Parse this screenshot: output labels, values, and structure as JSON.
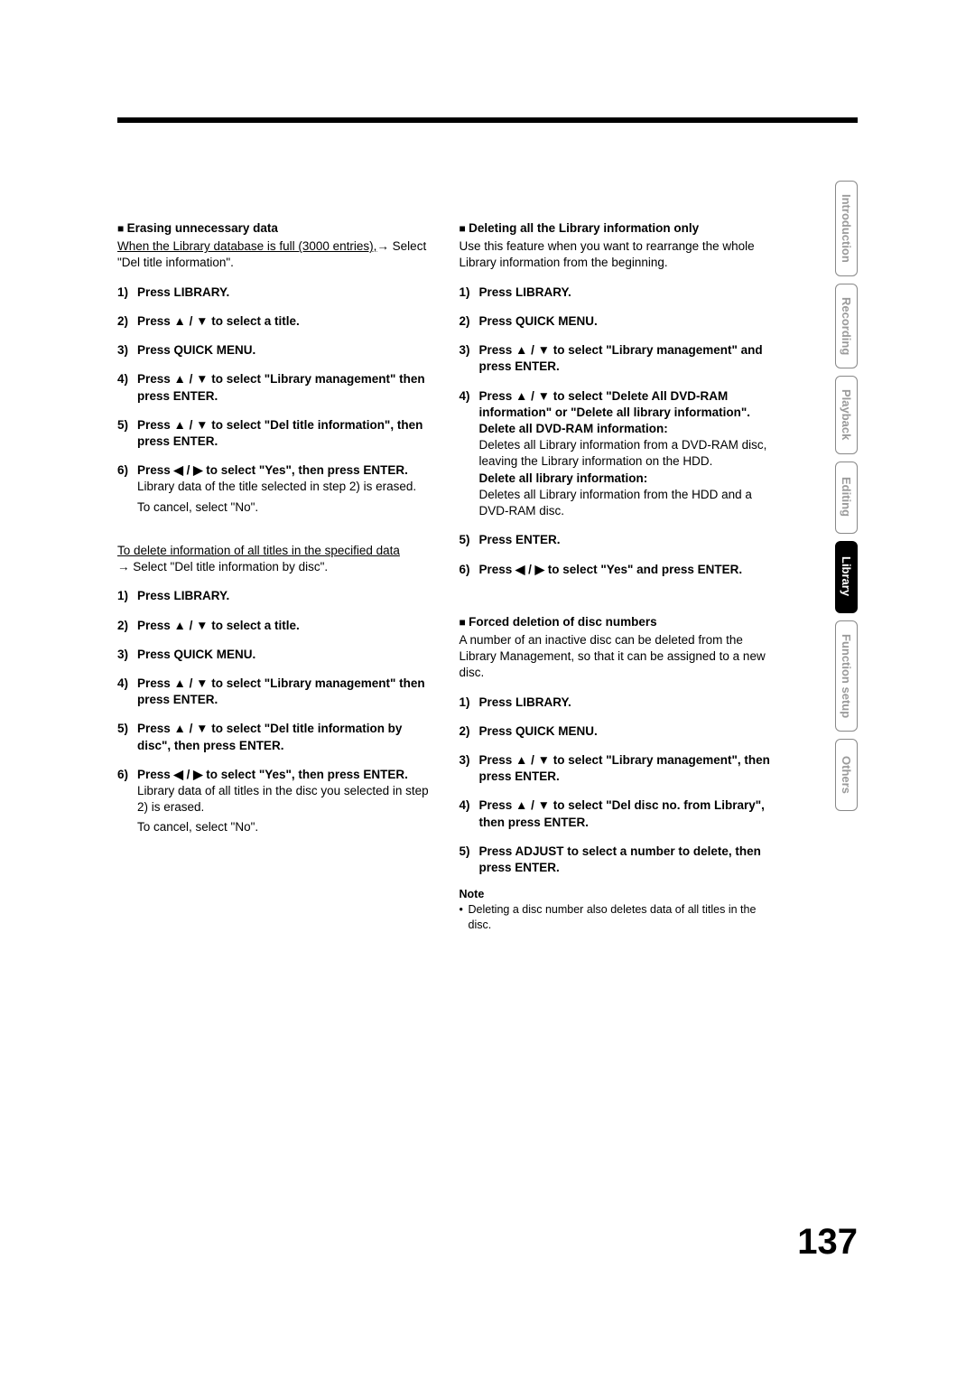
{
  "page_number": "137",
  "tabs": [
    "Introduction",
    "Recording",
    "Playback",
    "Editing",
    "Library",
    "Function setup",
    "Others"
  ],
  "active_tab_index": 4,
  "left": {
    "sec1": {
      "title": "Erasing unnecessary data",
      "intro_underline": "When the Library database is full (3000 entries),",
      "intro_arrow": "→",
      "intro_rest": "Select \"Del title information\".",
      "steps": [
        {
          "num": "1)",
          "head": "Press LIBRARY."
        },
        {
          "num": "2)",
          "head": "Press ▲ / ▼ to select a title."
        },
        {
          "num": "3)",
          "head": "Press QUICK MENU."
        },
        {
          "num": "4)",
          "head": "Press ▲ / ▼ to select \"Library management\" then press ENTER."
        },
        {
          "num": "5)",
          "head": "Press ▲ / ▼ to select \"Del title information\", then press ENTER."
        },
        {
          "num": "6)",
          "head": "Press ◀ / ▶ to select \"Yes\", then press ENTER.",
          "body": "Library data of the title selected in step 2) is erased.",
          "body2": "To cancel, select \"No\"."
        }
      ],
      "note_underline": "To delete information of all titles in the specified data",
      "note_rest": "→ Select \"Del title information by disc\".",
      "steps2": [
        {
          "num": "1)",
          "head": "Press LIBRARY."
        },
        {
          "num": "2)",
          "head": "Press ▲ / ▼ to select a title."
        },
        {
          "num": "3)",
          "head": "Press QUICK MENU."
        },
        {
          "num": "4)",
          "head": "Press ▲ / ▼ to select \"Library management\" then press ENTER."
        },
        {
          "num": "5)",
          "head": "Press ▲ / ▼ to select \"Del title information by disc\", then press ENTER."
        },
        {
          "num": "6)",
          "head": "Press ◀ / ▶ to select \"Yes\", then press ENTER.",
          "body": "Library data of all titles in the disc you selected in step 2) is erased.",
          "body2": "To cancel, select \"No\"."
        }
      ]
    }
  },
  "right": {
    "sec1": {
      "title": "Deleting all the Library information only",
      "intro": "Use this feature when you want to rearrange the whole Library information from the beginning.",
      "steps": [
        {
          "num": "1)",
          "head": "Press LIBRARY."
        },
        {
          "num": "2)",
          "head": "Press QUICK MENU."
        },
        {
          "num": "3)",
          "head": "Press ▲ / ▼ to select \"Library management\" and press ENTER."
        },
        {
          "num": "4)",
          "head": "Press ▲ / ▼ to select \"Delete All DVD-RAM information\" or \"Delete all library information\".",
          "sub1h": "Delete all DVD-RAM information:",
          "sub1b": "Deletes all Library information from a DVD-RAM disc, leaving the Library information on the HDD.",
          "sub2h": "Delete all library information:",
          "sub2b": "Deletes all Library information from the HDD and a DVD-RAM disc."
        },
        {
          "num": "5)",
          "head": "Press ENTER."
        },
        {
          "num": "6)",
          "head": "Press ◀ / ▶ to select \"Yes\" and press ENTER."
        }
      ]
    },
    "sec2": {
      "title": "Forced deletion of disc numbers",
      "intro": "A number of an inactive disc can be deleted from the Library Management, so that it can be assigned to a new disc.",
      "steps": [
        {
          "num": "1)",
          "head": "Press LIBRARY."
        },
        {
          "num": "2)",
          "head": "Press QUICK MENU."
        },
        {
          "num": "3)",
          "head": "Press ▲ / ▼ to select \"Library management\", then press ENTER."
        },
        {
          "num": "4)",
          "head": "Press ▲ / ▼ to select \"Del disc no. from Library\", then press ENTER."
        },
        {
          "num": "5)",
          "head": "Press ADJUST to select a number to delete, then press ENTER."
        }
      ],
      "note_head": "Note",
      "note_body": "Deleting a disc number also deletes data of all titles in the disc."
    }
  }
}
